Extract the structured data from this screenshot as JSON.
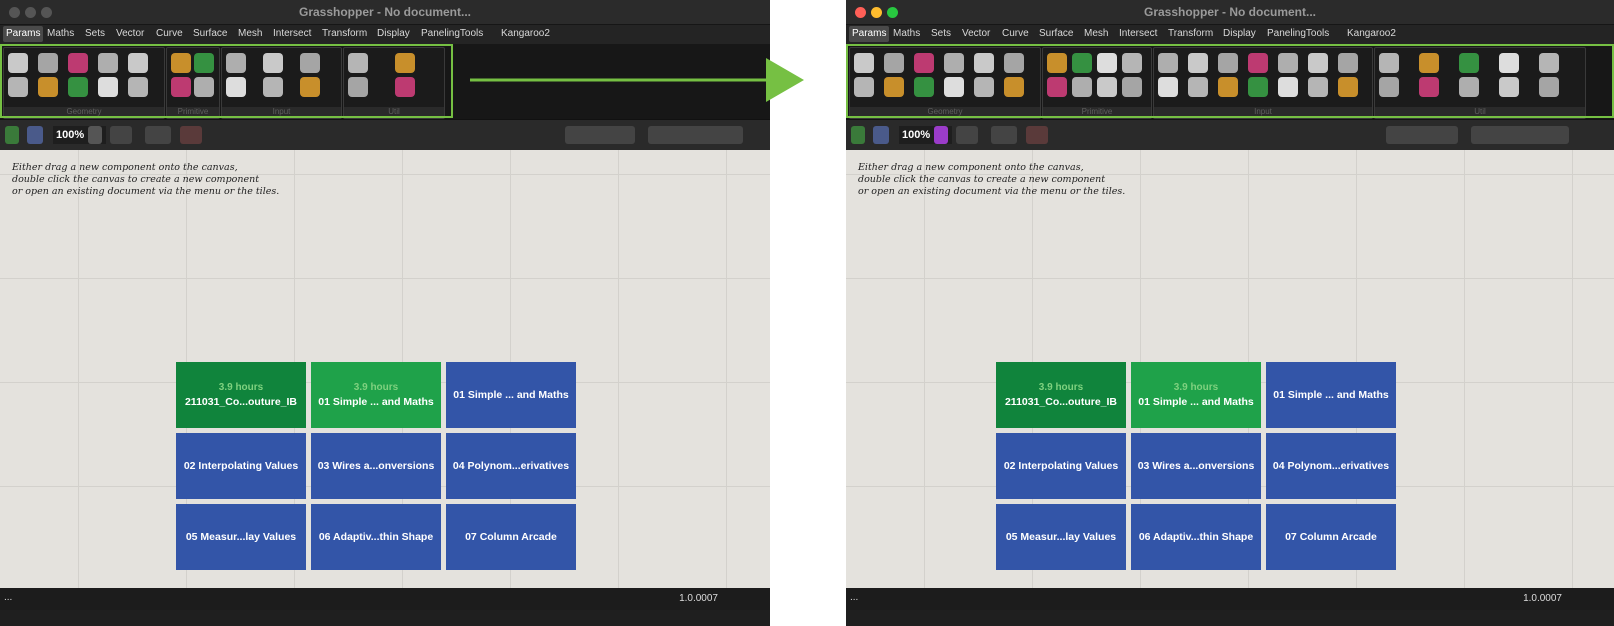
{
  "window": {
    "title": "Grasshopper - No document..."
  },
  "menu": [
    "Params",
    "Maths",
    "Sets",
    "Vector",
    "Curve",
    "Surface",
    "Mesh",
    "Intersect",
    "Transform",
    "Display",
    "PanelingTools",
    "Kangaroo2"
  ],
  "panels_before": [
    "Geometry",
    "Primitive",
    "Input",
    "Util"
  ],
  "panels_after": [
    "Geometry",
    "Primitive",
    "Input",
    "Util"
  ],
  "toolbar": {
    "zoom": "100%"
  },
  "canvas": {
    "hint_lines": [
      "Either drag a new component onto the canvas,",
      "double click the canvas to create a new component",
      "or open an existing document via the menu or the tiles."
    ]
  },
  "tiles": [
    {
      "hours": "3.9 hours",
      "label": "211031_Co...outure_IB",
      "color": "#10843c"
    },
    {
      "hours": "3.9 hours",
      "label": "01 Simple ... and Maths",
      "color": "#1fa24a"
    },
    {
      "hours": "",
      "label": "01 Simple ... and Maths",
      "color": "#3355a8"
    },
    {
      "hours": "",
      "label": "02 Interpolating Values",
      "color": "#3355a8"
    },
    {
      "hours": "",
      "label": "03 Wires a...onversions",
      "color": "#3355a8"
    },
    {
      "hours": "",
      "label": "04 Polynom...erivatives",
      "color": "#3355a8"
    },
    {
      "hours": "",
      "label": "05 Measur...lay Values",
      "color": "#3355a8"
    },
    {
      "hours": "",
      "label": "06 Adaptiv...thin Shape",
      "color": "#3355a8"
    },
    {
      "hours": "",
      "label": "07 Column Arcade",
      "color": "#3355a8"
    }
  ],
  "status": {
    "left": "...",
    "version": "1.0.0007"
  },
  "colors": {
    "highlight": "#76c043",
    "arrow": "#76c043",
    "canvas": "#e4e2dd"
  },
  "icons": [
    "close-icon",
    "minimize-icon",
    "zoom-icon",
    "save-icon",
    "new-document-icon",
    "dropdown-chevron-icon",
    "eye-icon",
    "sketch-icon",
    "arrow-right-icon"
  ],
  "tool_slots_before": {
    "Geometry": 10,
    "Primitive": 4,
    "Input": 6,
    "Util": 4
  },
  "tool_slots_after": {
    "Geometry": 12,
    "Primitive": 8,
    "Input": 14,
    "Util": 10
  }
}
